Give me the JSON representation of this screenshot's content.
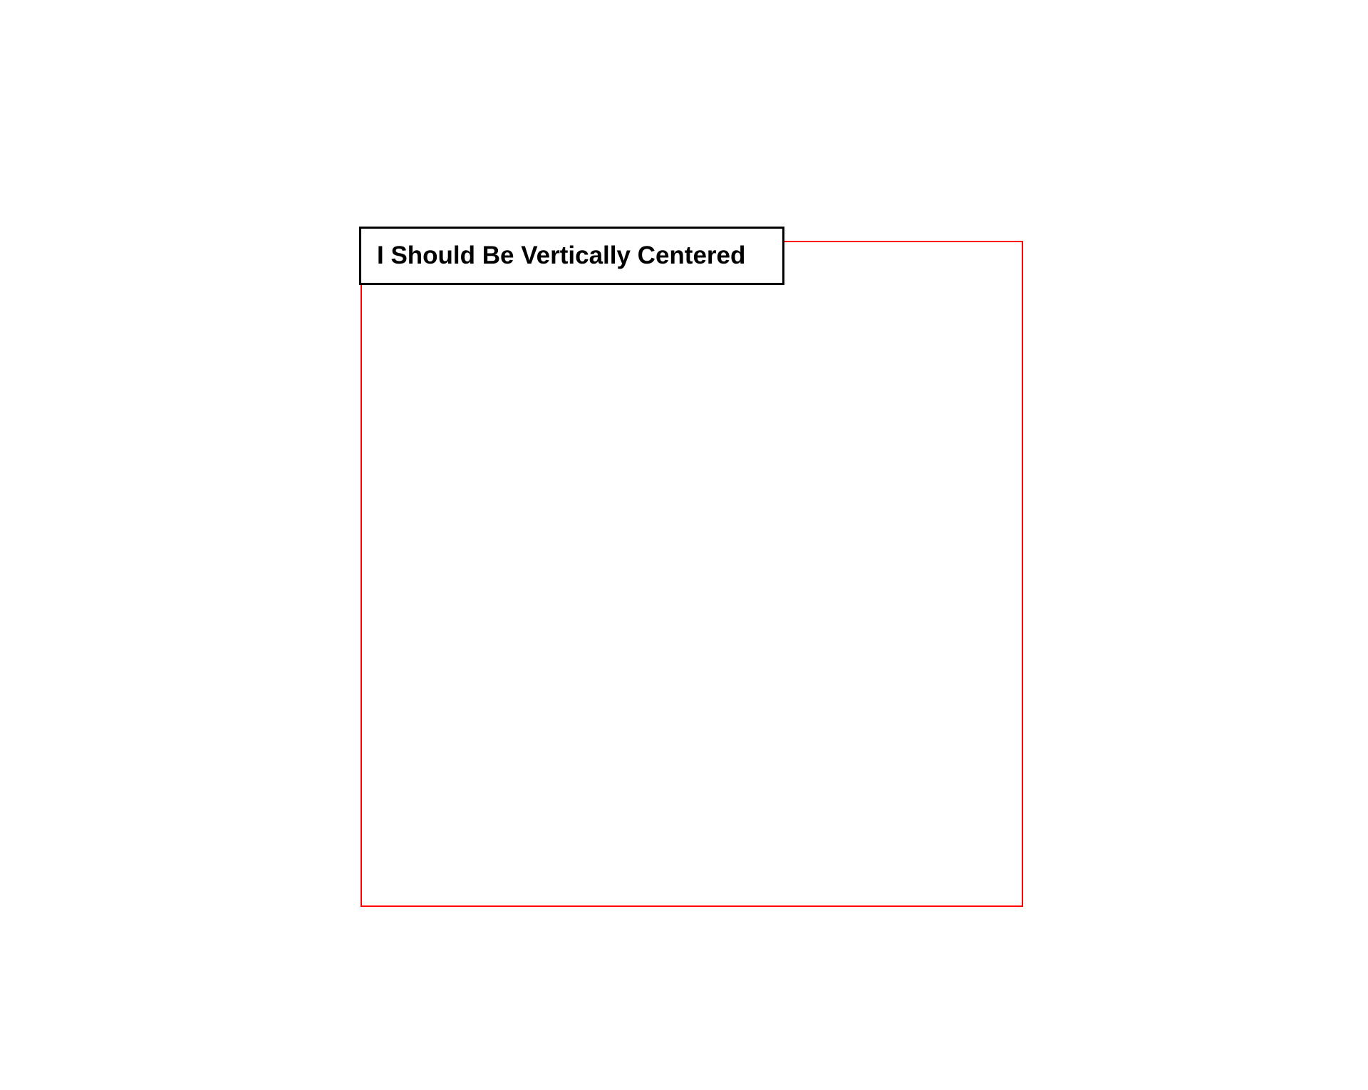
{
  "box": {
    "label": "I Should Be Vertically Centered"
  }
}
